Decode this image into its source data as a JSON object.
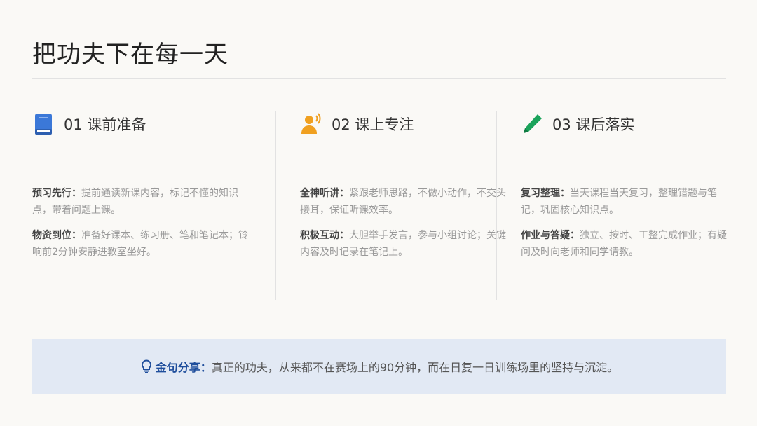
{
  "title": "把功夫下在每一天",
  "columns": [
    {
      "title": "01 课前准备",
      "icon": "book-icon",
      "color": "#3b78d8",
      "items": [
        {
          "key": "预习先行：",
          "text": "提前通读新课内容，标记不懂的知识点，带着问题上课。"
        },
        {
          "key": "物资到位：",
          "text": "准备好课本、练习册、笔和笔记本；铃响前2分钟安静进教室坐好。"
        }
      ]
    },
    {
      "title": "02 课上专注",
      "icon": "speaker-person-icon",
      "color": "#f0a020",
      "items": [
        {
          "key": "全神听讲：",
          "text": "紧跟老师思路，不做小动作，不交头接耳，保证听课效率。"
        },
        {
          "key": "积极互动：",
          "text": "大胆举手发言，参与小组讨论；关键内容及时记录在笔记上。"
        }
      ]
    },
    {
      "title": "03 课后落实",
      "icon": "pencil-icon",
      "color": "#1aa35a",
      "items": [
        {
          "key": "复习整理：",
          "text": "当天课程当天复习，整理错题与笔记，巩固核心知识点。"
        },
        {
          "key": "作业与答疑：",
          "text": "独立、按时、工整完成作业；有疑问及时向老师和同学请教。"
        }
      ]
    }
  ],
  "banner": {
    "icon": "lightbulb-icon",
    "lead": "金句分享：",
    "text": "真正的功夫，从来都不在赛场上的90分钟，而在日复一日训练场里的坚持与沉淀。"
  }
}
